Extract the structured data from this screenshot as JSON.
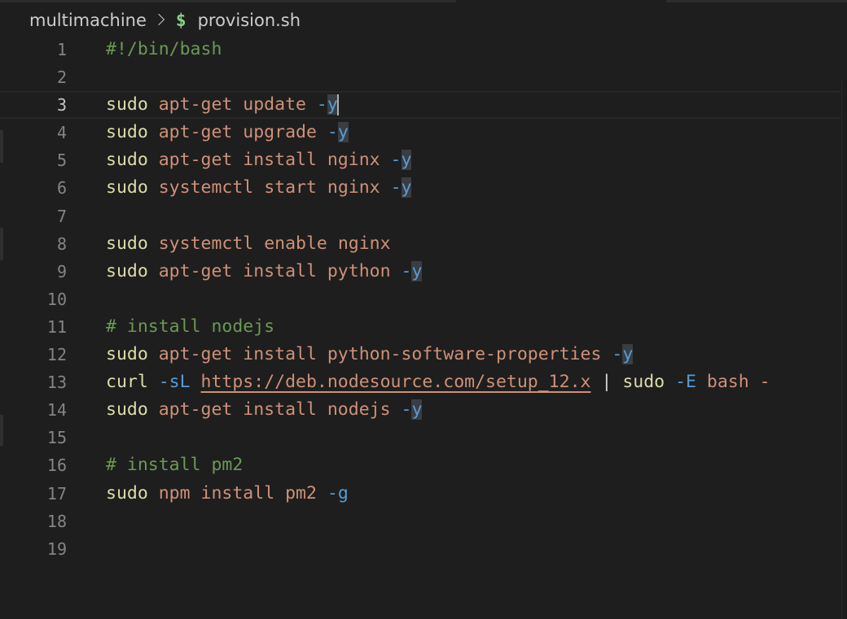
{
  "breadcrumb": {
    "folder": "multimachine",
    "file_icon": "$",
    "file": "provision.sh"
  },
  "editor": {
    "current_line": 3,
    "lines": [
      {
        "number": "1",
        "tokens": [
          {
            "t": "#!/bin/bash",
            "c": "com"
          }
        ]
      },
      {
        "number": "2",
        "tokens": []
      },
      {
        "number": "3",
        "tokens": [
          {
            "t": "sudo",
            "c": "cmd"
          },
          {
            "t": " "
          },
          {
            "t": "apt-get",
            "c": "arg"
          },
          {
            "t": " "
          },
          {
            "t": "update",
            "c": "arg"
          },
          {
            "t": " "
          },
          {
            "t": "-",
            "c": "opt"
          },
          {
            "t": "y",
            "c": "opt",
            "hl": true
          }
        ],
        "cursor": true
      },
      {
        "number": "4",
        "tokens": [
          {
            "t": "sudo",
            "c": "cmd"
          },
          {
            "t": " "
          },
          {
            "t": "apt-get",
            "c": "arg"
          },
          {
            "t": " "
          },
          {
            "t": "upgrade",
            "c": "arg"
          },
          {
            "t": " "
          },
          {
            "t": "-",
            "c": "opt"
          },
          {
            "t": "y",
            "c": "opt",
            "hl": true
          }
        ]
      },
      {
        "number": "5",
        "tokens": [
          {
            "t": "sudo",
            "c": "cmd"
          },
          {
            "t": " "
          },
          {
            "t": "apt-get",
            "c": "arg"
          },
          {
            "t": " "
          },
          {
            "t": "install",
            "c": "arg"
          },
          {
            "t": " "
          },
          {
            "t": "nginx",
            "c": "arg"
          },
          {
            "t": " "
          },
          {
            "t": "-",
            "c": "opt"
          },
          {
            "t": "y",
            "c": "opt",
            "hl": true
          }
        ]
      },
      {
        "number": "6",
        "tokens": [
          {
            "t": "sudo",
            "c": "cmd"
          },
          {
            "t": " "
          },
          {
            "t": "systemctl",
            "c": "arg"
          },
          {
            "t": " "
          },
          {
            "t": "start",
            "c": "arg"
          },
          {
            "t": " "
          },
          {
            "t": "nginx",
            "c": "arg"
          },
          {
            "t": " "
          },
          {
            "t": "-",
            "c": "opt"
          },
          {
            "t": "y",
            "c": "opt",
            "hl": true
          }
        ]
      },
      {
        "number": "7",
        "tokens": []
      },
      {
        "number": "8",
        "tokens": [
          {
            "t": "sudo",
            "c": "cmd"
          },
          {
            "t": " "
          },
          {
            "t": "systemctl",
            "c": "arg"
          },
          {
            "t": " "
          },
          {
            "t": "enable",
            "c": "arg"
          },
          {
            "t": " "
          },
          {
            "t": "nginx",
            "c": "arg"
          }
        ]
      },
      {
        "number": "9",
        "tokens": [
          {
            "t": "sudo",
            "c": "cmd"
          },
          {
            "t": " "
          },
          {
            "t": "apt-get",
            "c": "arg"
          },
          {
            "t": " "
          },
          {
            "t": "install",
            "c": "arg"
          },
          {
            "t": " "
          },
          {
            "t": "python",
            "c": "arg"
          },
          {
            "t": " "
          },
          {
            "t": "-",
            "c": "opt"
          },
          {
            "t": "y",
            "c": "opt",
            "hl": true
          }
        ]
      },
      {
        "number": "10",
        "tokens": []
      },
      {
        "number": "11",
        "tokens": [
          {
            "t": "# install nodejs",
            "c": "com"
          }
        ]
      },
      {
        "number": "12",
        "tokens": [
          {
            "t": "sudo",
            "c": "cmd"
          },
          {
            "t": " "
          },
          {
            "t": "apt-get",
            "c": "arg"
          },
          {
            "t": " "
          },
          {
            "t": "install",
            "c": "arg"
          },
          {
            "t": " "
          },
          {
            "t": "python-software-properties",
            "c": "arg"
          },
          {
            "t": " "
          },
          {
            "t": "-",
            "c": "opt"
          },
          {
            "t": "y",
            "c": "opt",
            "hl": true
          }
        ]
      },
      {
        "number": "13",
        "tokens": [
          {
            "t": "curl",
            "c": "cmd"
          },
          {
            "t": " "
          },
          {
            "t": "-sL",
            "c": "opt"
          },
          {
            "t": " "
          },
          {
            "t": "https://deb.nodesource.com/setup_12.x",
            "c": "url"
          },
          {
            "t": " "
          },
          {
            "t": "|",
            "c": "pipe"
          },
          {
            "t": " "
          },
          {
            "t": "sudo",
            "c": "cmd"
          },
          {
            "t": " "
          },
          {
            "t": "-E",
            "c": "opt"
          },
          {
            "t": " "
          },
          {
            "t": "bash",
            "c": "arg"
          },
          {
            "t": " "
          },
          {
            "t": "-",
            "c": "arg"
          }
        ]
      },
      {
        "number": "14",
        "tokens": [
          {
            "t": "sudo",
            "c": "cmd"
          },
          {
            "t": " "
          },
          {
            "t": "apt-get",
            "c": "arg"
          },
          {
            "t": " "
          },
          {
            "t": "install",
            "c": "arg"
          },
          {
            "t": " "
          },
          {
            "t": "nodejs",
            "c": "arg"
          },
          {
            "t": " "
          },
          {
            "t": "-",
            "c": "opt"
          },
          {
            "t": "y",
            "c": "opt",
            "hl": true
          }
        ]
      },
      {
        "number": "15",
        "tokens": []
      },
      {
        "number": "16",
        "tokens": [
          {
            "t": "# install pm2",
            "c": "com"
          }
        ]
      },
      {
        "number": "17",
        "tokens": [
          {
            "t": "sudo",
            "c": "cmd"
          },
          {
            "t": " "
          },
          {
            "t": "npm",
            "c": "arg"
          },
          {
            "t": " "
          },
          {
            "t": "install",
            "c": "arg"
          },
          {
            "t": " "
          },
          {
            "t": "pm2",
            "c": "arg"
          },
          {
            "t": " "
          },
          {
            "t": "-g",
            "c": "opt"
          }
        ]
      },
      {
        "number": "18",
        "tokens": []
      },
      {
        "number": "19",
        "tokens": []
      }
    ]
  },
  "colors": {
    "background": "#1e1e1e",
    "command": "#dcdcaa",
    "argument": "#ce9178",
    "option": "#569cd6",
    "comment": "#6a9955",
    "line_number": "#858585",
    "breadcrumb_icon": "#89d185"
  }
}
